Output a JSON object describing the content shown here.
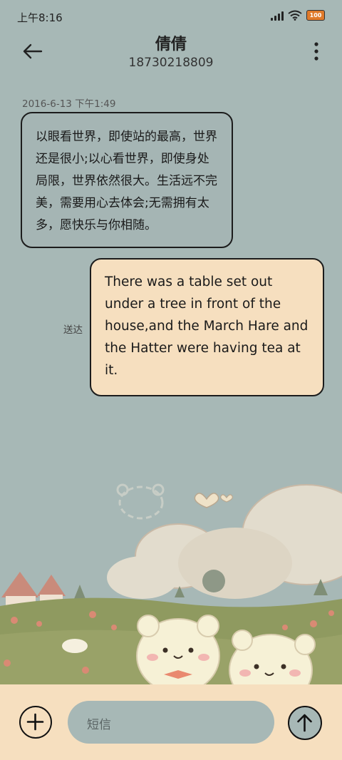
{
  "status_bar": {
    "time": "上午8:16",
    "battery": "100"
  },
  "header": {
    "contact_name": "倩倩",
    "contact_number": "18730218809"
  },
  "conversation": {
    "timestamp": "2016-6-13 下午1:49",
    "incoming": {
      "text": "以眼看世界，即使站的最高，世界还是很小;以心看世界，即使身处局限，世界依然很大。生活远不完美，需要用心去体会;无需拥有太多，愿快乐与你相随。"
    },
    "outgoing": {
      "text": "There was a table set out under a tree in front of the house,and the March Hare and the Hatter were having tea at it.",
      "status": "送达"
    }
  },
  "composer": {
    "placeholder": "短信"
  },
  "icons": {
    "back": "arrow-left-icon",
    "more": "more-vertical-icon",
    "add": "plus-circle-icon",
    "send": "arrow-up-icon"
  },
  "colors": {
    "background": "#a7b8b6",
    "bubble_out": "#f6dfbf",
    "bubble_in": "#a5b5b4",
    "composer_bar": "#f6dfbf"
  }
}
